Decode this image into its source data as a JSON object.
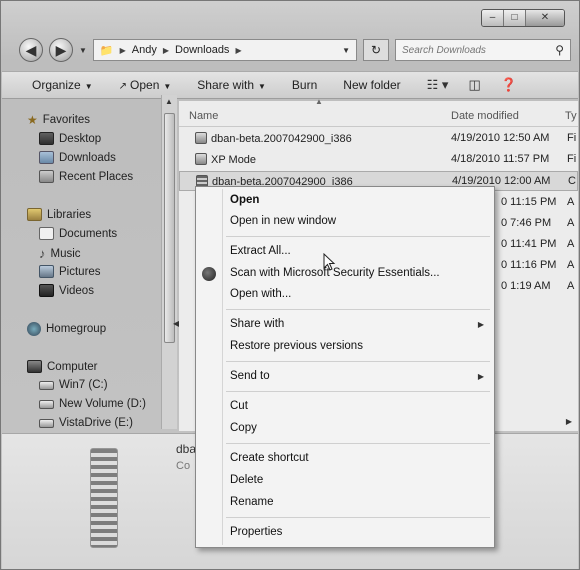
{
  "caption": {
    "minimize": "–",
    "maximize": "□",
    "close": "✕"
  },
  "nav": {
    "back_glyph": "◀",
    "forward_glyph": "▶",
    "breadcrumb": [
      "Andy",
      "Downloads"
    ],
    "search_placeholder": "Search Downloads"
  },
  "toolbar": {
    "organize": "Organize",
    "open": "Open",
    "share_with": "Share with",
    "burn": "Burn",
    "new_folder": "New folder"
  },
  "sidebar": {
    "favorites": "Favorites",
    "desktop": "Desktop",
    "downloads": "Downloads",
    "recent": "Recent Places",
    "libraries": "Libraries",
    "documents": "Documents",
    "music": "Music",
    "pictures": "Pictures",
    "videos": "Videos",
    "homegroup": "Homegroup",
    "computer": "Computer",
    "drive_c": "Win7 (C:)",
    "drive_d": "New Volume (D:)",
    "drive_e": "VistaDrive (E:)"
  },
  "filelist": {
    "columns": {
      "name": "Name",
      "date": "Date modified",
      "type": "Ty"
    },
    "rows": [
      {
        "name": "dban-beta.2007042900_i386",
        "date": "4/19/2010 12:50 AM",
        "type": "Fi"
      },
      {
        "name": "XP Mode",
        "date": "4/18/2010 11:57 PM",
        "type": "Fi"
      },
      {
        "name": "dban-beta.2007042900_i386",
        "date": "4/19/2010 12:00 AM",
        "type": "C"
      },
      {
        "name": "",
        "date": "0 11:15 PM",
        "type": "A"
      },
      {
        "name": "",
        "date": "0 7:46 PM",
        "type": "A"
      },
      {
        "name": "",
        "date": "0 11:41 PM",
        "type": "A"
      },
      {
        "name": "",
        "date": "0 11:16 PM",
        "type": "A"
      },
      {
        "name": "",
        "date": "0 1:19 AM",
        "type": "A"
      }
    ]
  },
  "details": {
    "name": "dba",
    "type": "Co"
  },
  "context_menu": {
    "open": "Open",
    "open_new_window": "Open in new window",
    "extract_all": "Extract All...",
    "scan": "Scan with Microsoft Security Essentials...",
    "open_with": "Open with...",
    "share_with": "Share with",
    "restore": "Restore previous versions",
    "send_to": "Send to",
    "cut": "Cut",
    "copy": "Copy",
    "create_shortcut": "Create shortcut",
    "delete": "Delete",
    "rename": "Rename",
    "properties": "Properties"
  }
}
